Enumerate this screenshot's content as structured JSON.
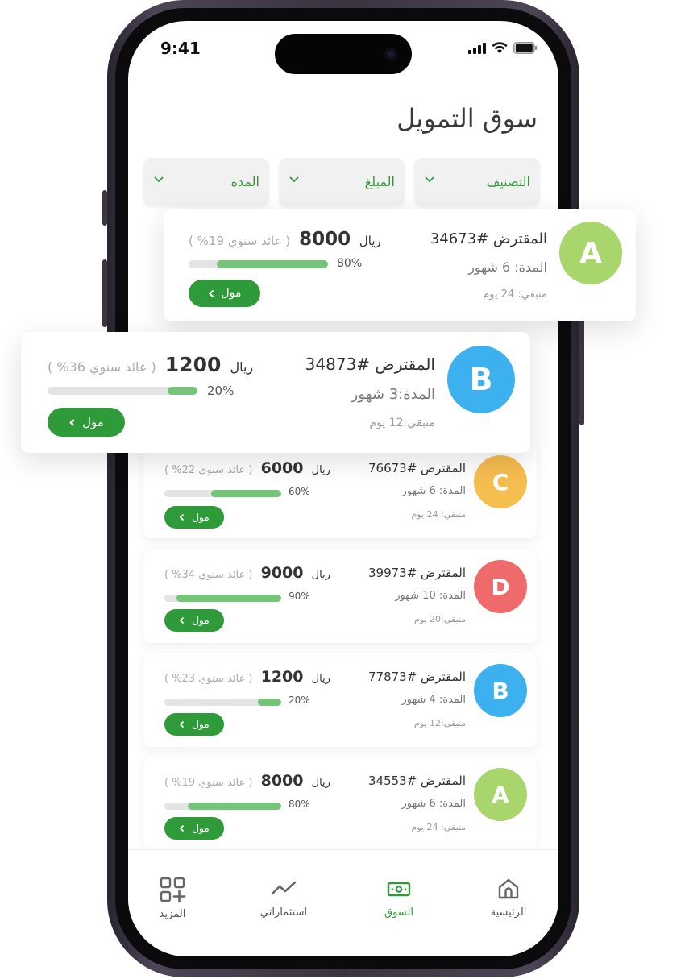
{
  "status_bar": {
    "time": "9:41"
  },
  "page": {
    "title": "سوق التمويل"
  },
  "filters": [
    {
      "label": "التصنيف"
    },
    {
      "label": "المبلغ"
    },
    {
      "label": "المدة"
    }
  ],
  "cards": [
    {
      "letter": "A",
      "color": "#a8d66c",
      "borrower": "المقترض #34673",
      "duration": "المدة: 6 شهور",
      "remaining": "متبقي: 24 يوم",
      "currency": "ريال",
      "amount": "8000",
      "yield": "( عائد سنوي 19% )",
      "progress": 0.8,
      "percent": "80%",
      "fund_label": "مول"
    },
    {
      "letter": "B",
      "color": "#3db1ef",
      "borrower": "المقترض #34873",
      "duration": "المدة:3 شهور",
      "remaining": "متبقي:12 يوم",
      "currency": "ريال",
      "amount": "1200",
      "yield": "( عائد سنوي 36% )",
      "progress": 0.2,
      "percent": "20%",
      "fund_label": "مول"
    },
    {
      "letter": "C",
      "color": "#f6bd4f",
      "borrower": "المقترض #76673",
      "duration": "المدة: 6 شهور",
      "remaining": "متبقي: 24 يوم",
      "currency": "ريال",
      "amount": "6000",
      "yield": "( عائد سنوي 22% )",
      "progress": 0.6,
      "percent": "60%",
      "fund_label": "مول"
    },
    {
      "letter": "D",
      "color": "#ef6b6b",
      "borrower": "المقترض #39973",
      "duration": "المدة: 10 شهور",
      "remaining": "متبقي:20 يوم",
      "currency": "ريال",
      "amount": "9000",
      "yield": "( عائد سنوي 34% )",
      "progress": 0.9,
      "percent": "90%",
      "fund_label": "مول"
    },
    {
      "letter": "B",
      "color": "#3db1ef",
      "borrower": "المقترض #77873",
      "duration": "المدة: 4 شهور",
      "remaining": "متبقي:12 يوم",
      "currency": "ريال",
      "amount": "1200",
      "yield": "( عائد سنوي 23% )",
      "progress": 0.2,
      "percent": "20%",
      "fund_label": "مول"
    },
    {
      "letter": "A",
      "color": "#a8d66c",
      "borrower": "المقترض #34553",
      "duration": "المدة: 6 شهور",
      "remaining": "متبقي: 24 يوم",
      "currency": "ريال",
      "amount": "8000",
      "yield": "( عائد سنوي 19% )",
      "progress": 0.8,
      "percent": "80%",
      "fund_label": "مول"
    }
  ],
  "nav": [
    {
      "label": "الرئيسية",
      "icon": "home-icon",
      "active": false
    },
    {
      "label": "السوق",
      "icon": "cash-icon",
      "active": true
    },
    {
      "label": "استثماراتي",
      "icon": "trend-icon",
      "active": false
    },
    {
      "label": "المزيد",
      "icon": "grid-plus-icon",
      "active": false
    }
  ],
  "colors": {
    "accent": "#2e9a39",
    "progress_fill": "#76c479"
  }
}
